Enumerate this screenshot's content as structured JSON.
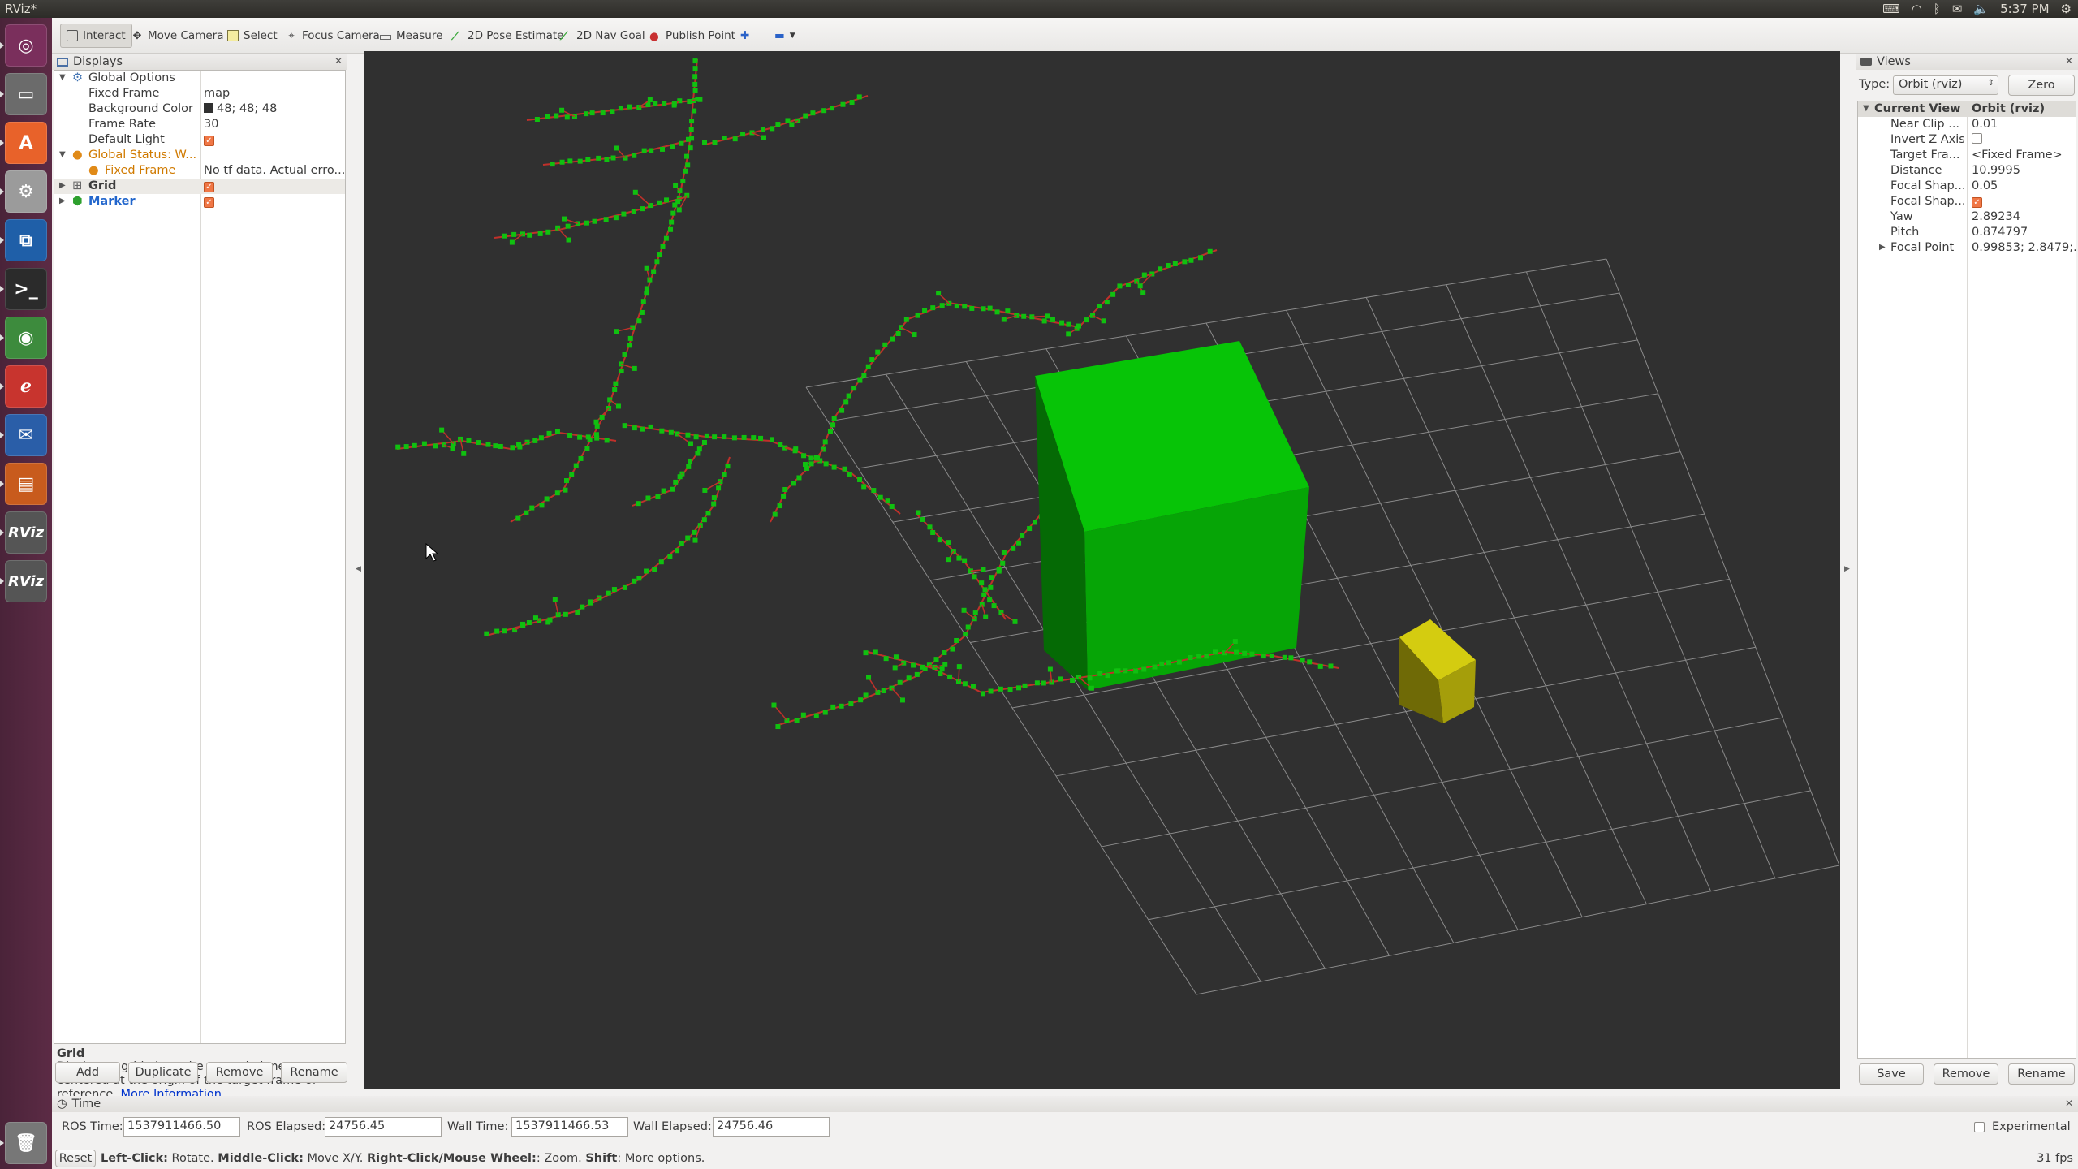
{
  "window": {
    "title": "RViz*",
    "clock": "5:37 PM"
  },
  "launcher": [
    {
      "name": "ubuntu-dash-icon",
      "color": "#7a2f5c",
      "glyph": "◎"
    },
    {
      "name": "files-icon",
      "color": "#6b6b6b",
      "glyph": "▭"
    },
    {
      "name": "software-center-icon",
      "color": "#e8622a",
      "glyph": "A"
    },
    {
      "name": "system-settings-icon",
      "color": "#9b9b9b",
      "glyph": "⚙"
    },
    {
      "name": "vscode-icon",
      "color": "#1f5fa8",
      "glyph": "⧉"
    },
    {
      "name": "terminal-icon",
      "color": "#2b2b2b",
      "glyph": ">_"
    },
    {
      "name": "chrome-icon",
      "color": "#3d8b3d",
      "glyph": "◉"
    },
    {
      "name": "pdf-viewer-icon",
      "color": "#c8342e",
      "glyph": "ℯ"
    },
    {
      "name": "thunderbird-icon",
      "color": "#2a5ea8",
      "glyph": "✉"
    },
    {
      "name": "impress-icon",
      "color": "#c85b1d",
      "glyph": "▤"
    },
    {
      "name": "rviz-icon-1",
      "color": "#555555",
      "glyph": "RViz"
    },
    {
      "name": "rviz-icon-2",
      "color": "#555555",
      "glyph": "RViz"
    },
    {
      "name": "trash-icon",
      "color": "#777777",
      "glyph": "🗑"
    }
  ],
  "toolbar": {
    "interact": "Interact",
    "move_camera": "Move Camera",
    "select": "Select",
    "focus_camera": "Focus Camera",
    "measure": "Measure",
    "pose_estimate": "2D Pose Estimate",
    "nav_goal": "2D Nav Goal",
    "publish_point": "Publish Point"
  },
  "displays": {
    "title": "Displays",
    "global_options": "Global Options",
    "fixed_frame_label": "Fixed Frame",
    "fixed_frame_value": "map",
    "background_color_label": "Background Color",
    "background_color_value": "48; 48; 48",
    "frame_rate_label": "Frame Rate",
    "frame_rate_value": "30",
    "default_light_label": "Default Light",
    "global_status": "Global Status: W...",
    "status_fixed_frame": "Fixed Frame",
    "status_fixed_frame_value": "No tf data.  Actual erro...",
    "grid": "Grid",
    "marker": "Marker"
  },
  "description": {
    "title": "Grid",
    "text": "Displays a grid along the ground plane, centered at the origin of the target frame of reference.",
    "link": "More Information",
    "suffix": "."
  },
  "display_buttons": {
    "add": "Add",
    "duplicate": "Duplicate",
    "remove": "Remove",
    "rename": "Rename"
  },
  "views": {
    "title": "Views",
    "type_label": "Type:",
    "type_value": "Orbit (rviz)",
    "zero": "Zero",
    "current_view": "Current View",
    "current_view_type": "Orbit (rviz)",
    "props": [
      {
        "label": "Near Clip ...",
        "value": "0.01",
        "kind": "text"
      },
      {
        "label": "Invert Z Axis",
        "value": "",
        "kind": "uncheck"
      },
      {
        "label": "Target Fra...",
        "value": "<Fixed Frame>",
        "kind": "text"
      },
      {
        "label": "Distance",
        "value": "10.9995",
        "kind": "text"
      },
      {
        "label": "Focal Shap...",
        "value": "0.05",
        "kind": "text"
      },
      {
        "label": "Focal Shap...",
        "value": "",
        "kind": "check"
      },
      {
        "label": "Yaw",
        "value": "2.89234",
        "kind": "text"
      },
      {
        "label": "Pitch",
        "value": "0.874797",
        "kind": "text"
      },
      {
        "label": "Focal Point",
        "value": "0.99853; 2.8479;...",
        "kind": "text"
      }
    ],
    "save": "Save",
    "remove": "Remove",
    "rename": "Rename"
  },
  "time": {
    "title": "Time",
    "ros_time_label": "ROS Time:",
    "ros_time": "1537911466.50",
    "ros_elapsed_label": "ROS Elapsed:",
    "ros_elapsed": "24756.45",
    "wall_time_label": "Wall Time:",
    "wall_time": "1537911466.53",
    "wall_elapsed_label": "Wall Elapsed:",
    "wall_elapsed": "24756.46",
    "experimental": "Experimental"
  },
  "status": {
    "reset": "Reset",
    "k1": "Left-Click:",
    "v1": " Rotate. ",
    "k2": "Middle-Click:",
    "v2": " Move X/Y. ",
    "k3": "Right-Click/Mouse Wheel:",
    "v3": ": Zoom. ",
    "k4": "Shift",
    "v4": ": More options.",
    "fps": "31 fps"
  }
}
